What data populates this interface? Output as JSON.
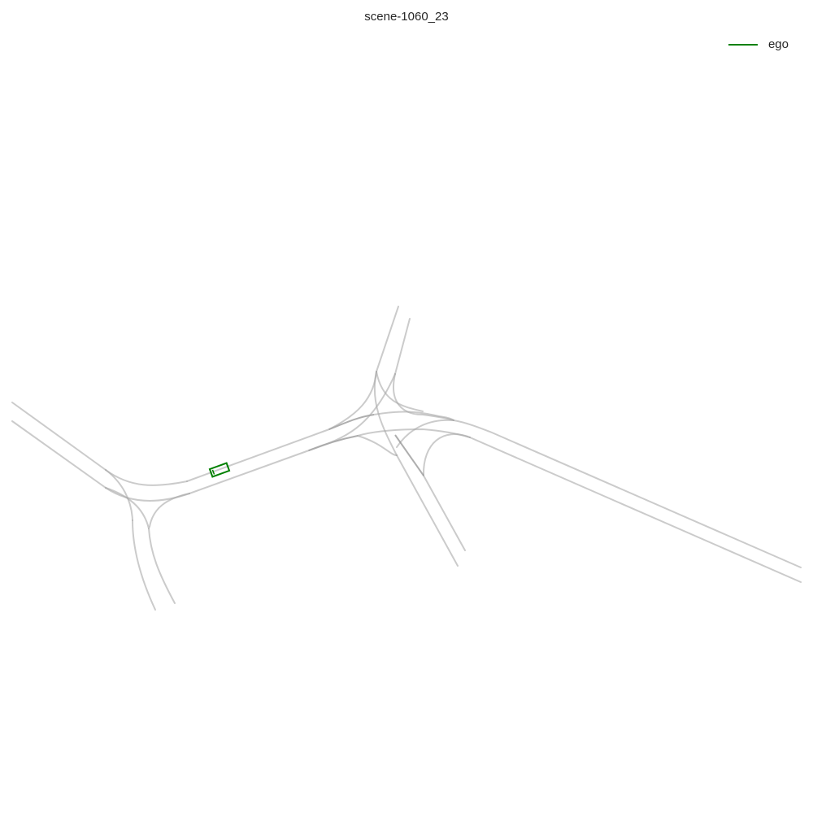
{
  "title": "scene-1060_23",
  "legend": {
    "items": [
      {
        "label": "ego",
        "color": "#008000"
      }
    ]
  },
  "colors": {
    "lane": "#a8a8a8",
    "ego": "#008000",
    "text": "#262626"
  }
}
